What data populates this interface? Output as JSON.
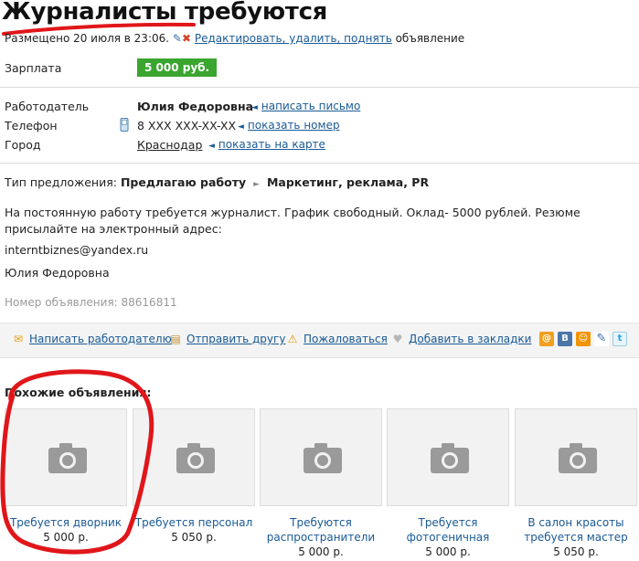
{
  "title": "Журналисты требуются",
  "meta": {
    "posted": "Размещено 20 июля в 23:06.",
    "edit_link": "Редактировать, удалить, поднять",
    "suffix": "объявление"
  },
  "salary": {
    "label": "Зарплата",
    "value": "5 000 руб."
  },
  "employer": {
    "label": "Работодатель",
    "name": "Юлия Федоровна",
    "action": "написать письмо"
  },
  "phone": {
    "label": "Телефон",
    "value": "8 XXX XXX-XX-XX",
    "action": "показать номер"
  },
  "city": {
    "label": "Город",
    "value": "Краснодар",
    "action": "показать на карте"
  },
  "offer": {
    "label": "Тип предложения:",
    "type": "Предлагаю работу",
    "category": "Маркетинг, реклама, PR"
  },
  "description": {
    "text": "На постоянную работу требуется журналист. График свободный. Оклад- 5000 рублей. Резюме присылайте на электронный адрес:",
    "email": "interntbiznes@yandex.ru",
    "signature": "Юлия Федоровна",
    "ad_number": "Номер объявления: 88616811"
  },
  "actions": {
    "write": "Написать работодателю",
    "send": "Отправить другу",
    "complain": "Пожаловаться",
    "bookmark": "Добавить в закладки"
  },
  "social_icons": [
    "mail-ru-icon",
    "vkontakte-icon",
    "odnoklassniki-icon",
    "livejournal-icon",
    "twitter-icon"
  ],
  "colors": {
    "link": "#1a5a96",
    "salary_badge": "#3aa52f",
    "annotation_red": "#e0161a"
  },
  "similar": {
    "title": "Похожие объявления:",
    "items": [
      {
        "title": "Требуется дворник",
        "price": "5 000 р."
      },
      {
        "title": "Требуется персонал",
        "price": "5 050 р."
      },
      {
        "title": "Требуются распространители",
        "price": "5 000 р."
      },
      {
        "title": "Требуется фотогеничная",
        "price": "5 000 р."
      },
      {
        "title": "В салон красоты требуется мастер",
        "price": "5 050 р."
      }
    ]
  }
}
